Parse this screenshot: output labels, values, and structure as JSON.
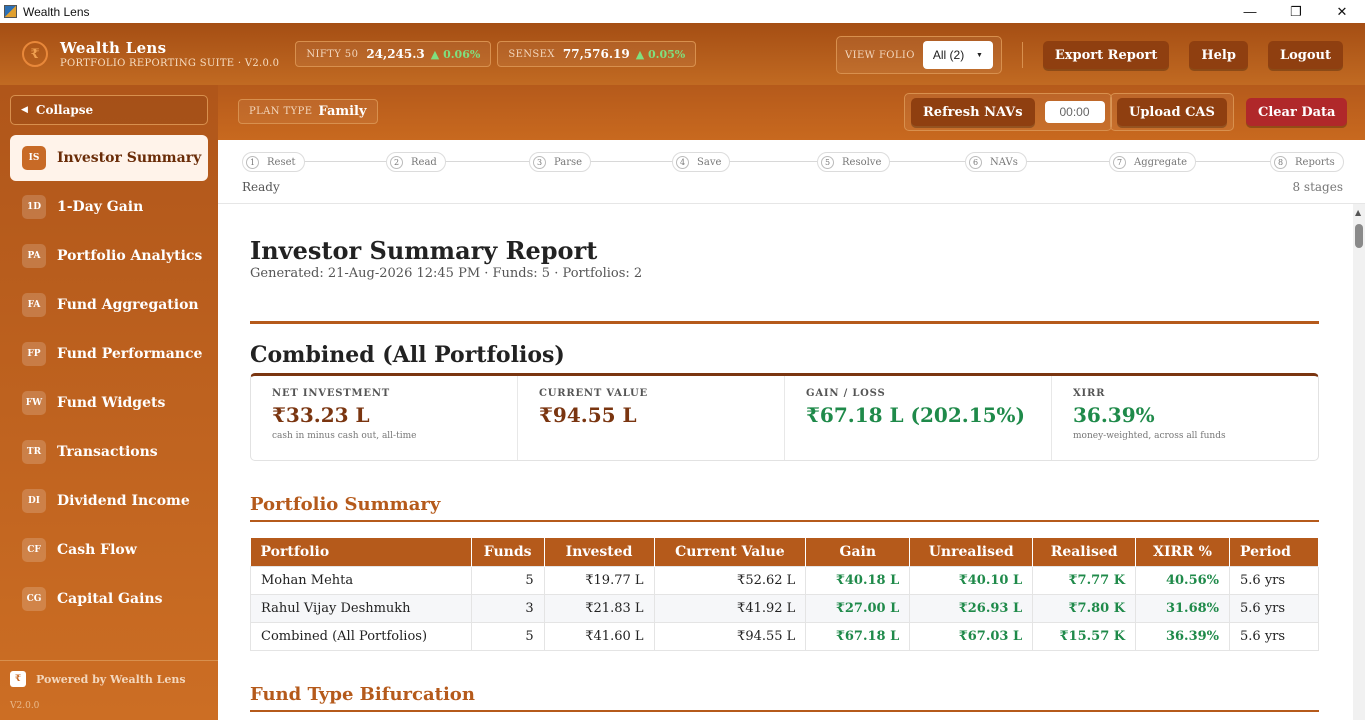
{
  "window": {
    "title": "Wealth Lens",
    "minimize": "—",
    "restore": "❐",
    "close": "✕"
  },
  "header": {
    "brand_name": "Wealth Lens",
    "brand_sub": "PORTFOLIO REPORTING SUITE · V2.0.0",
    "tickers": [
      {
        "label": "NIFTY 50",
        "value": "24,245.3",
        "change": "▲ 0.06%"
      },
      {
        "label": "SENSEX",
        "value": "77,576.19",
        "change": "▲ 0.05%"
      }
    ],
    "view_folio_label": "VIEW FOLIO",
    "view_folio_value": "All (2)",
    "export_label": "Export Report",
    "help_label": "Help",
    "logout_label": "Logout"
  },
  "toolbar": {
    "plan_label": "PLAN TYPE",
    "plan_value": "Family",
    "refresh_label": "Refresh NAVs",
    "timer": "00:00",
    "upload_label": "Upload CAS",
    "clear_label": "Clear Data"
  },
  "sidebar": {
    "collapse_label": "Collapse",
    "items": [
      {
        "abbr": "IS",
        "label": "Investor Summary"
      },
      {
        "abbr": "1D",
        "label": "1-Day Gain"
      },
      {
        "abbr": "PA",
        "label": "Portfolio Analytics"
      },
      {
        "abbr": "FA",
        "label": "Fund Aggregation"
      },
      {
        "abbr": "FP",
        "label": "Fund Performance"
      },
      {
        "abbr": "FW",
        "label": "Fund Widgets"
      },
      {
        "abbr": "TR",
        "label": "Transactions"
      },
      {
        "abbr": "DI",
        "label": "Dividend Income"
      },
      {
        "abbr": "CF",
        "label": "Cash Flow"
      },
      {
        "abbr": "CG",
        "label": "Capital Gains"
      }
    ],
    "powered": "Powered by Wealth Lens",
    "version": "V2.0.0"
  },
  "pipeline": {
    "steps": [
      {
        "n": "1",
        "label": "Reset"
      },
      {
        "n": "2",
        "label": "Read"
      },
      {
        "n": "3",
        "label": "Parse"
      },
      {
        "n": "4",
        "label": "Save"
      },
      {
        "n": "5",
        "label": "Resolve"
      },
      {
        "n": "6",
        "label": "NAVs"
      },
      {
        "n": "7",
        "label": "Aggregate"
      },
      {
        "n": "8",
        "label": "Reports"
      }
    ],
    "status": "Ready",
    "stages": "8 stages"
  },
  "report": {
    "title": "Investor Summary Report",
    "subtitle": "Generated: 21-Aug-2026 12:45 PM · Funds: 5 · Portfolios: 2",
    "combined_heading": "Combined (All Portfolios)",
    "cards": [
      {
        "label": "NET INVESTMENT",
        "value": "₹33.23 L",
        "note": "cash in minus cash out, all-time",
        "color": "#7a3510"
      },
      {
        "label": "CURRENT VALUE",
        "value": "₹94.55 L",
        "note": "",
        "color": "#7a3510"
      },
      {
        "label": "GAIN / LOSS",
        "value": "₹67.18 L (202.15%)",
        "note": "",
        "color": "#1f8a4a"
      },
      {
        "label": "XIRR",
        "value": "36.39%",
        "note": "money-weighted, across all funds",
        "color": "#1f8a4a"
      }
    ],
    "portfolio_heading": "Portfolio Summary",
    "columns": [
      "Portfolio",
      "Funds",
      "Invested",
      "Current Value",
      "Gain",
      "Unrealised",
      "Realised",
      "XIRR %",
      "Period"
    ],
    "rows": [
      [
        "Mohan Mehta",
        "5",
        "₹19.77 L",
        "₹52.62 L",
        "₹40.18 L",
        "₹40.10 L",
        "₹7.77 K",
        "40.56%",
        "5.6 yrs"
      ],
      [
        "Rahul Vijay Deshmukh",
        "3",
        "₹21.83 L",
        "₹41.92 L",
        "₹27.00 L",
        "₹26.93 L",
        "₹7.80 K",
        "31.68%",
        "5.6 yrs"
      ],
      [
        "Combined (All Portfolios)",
        "5",
        "₹41.60 L",
        "₹94.55 L",
        "₹67.18 L",
        "₹67.03 L",
        "₹15.57 K",
        "36.39%",
        "5.6 yrs"
      ]
    ],
    "fund_type_heading": "Fund Type Bifurcation"
  }
}
